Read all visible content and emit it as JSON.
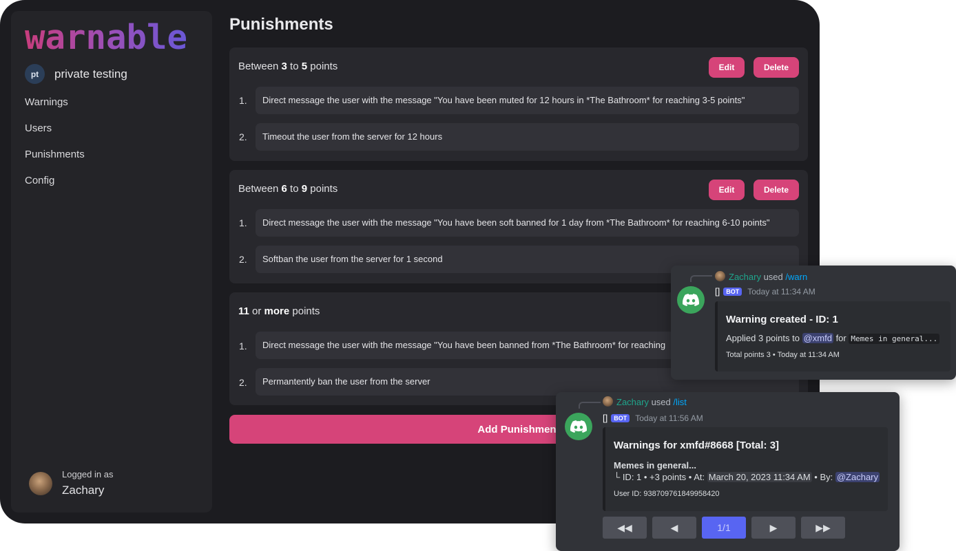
{
  "app": {
    "logo": "warnable",
    "page_title": "Punishments",
    "add_button": "Add Punishment"
  },
  "server": {
    "icon": "pt",
    "name": "private testing"
  },
  "nav": {
    "items": [
      "Warnings",
      "Users",
      "Punishments",
      "Config"
    ]
  },
  "user": {
    "logged_in_label": "Logged in as",
    "name": "Zachary"
  },
  "buttons": {
    "edit": "Edit",
    "delete": "Delete"
  },
  "punishments": [
    {
      "head": {
        "pre": "Between ",
        "a": "3",
        "mid": " to ",
        "b": "5",
        "post": " points"
      },
      "actions": [
        {
          "num": "1.",
          "text": "Direct message the user with the message \"You have been muted for 12 hours in *The Bathroom* for reaching 3-5 points\""
        },
        {
          "num": "2.",
          "text": "Timeout the user from the server for 12 hours"
        }
      ]
    },
    {
      "head": {
        "pre": "Between ",
        "a": "6",
        "mid": " to ",
        "b": "9",
        "post": " points"
      },
      "actions": [
        {
          "num": "1.",
          "text": "Direct message the user with the message \"You have been soft banned for 1 day from *The Bathroom* for reaching 6-10 points\""
        },
        {
          "num": "2.",
          "text": "Softban the user from the server for 1 second"
        }
      ]
    },
    {
      "head": {
        "pre": "",
        "a": "11",
        "mid": " or ",
        "b": "more",
        "post": " points"
      },
      "actions": [
        {
          "num": "1.",
          "text": "Direct message the user with the message \"You have been banned from *The Bathroom* for reaching"
        },
        {
          "num": "2.",
          "text": "Permantently ban the user from the server"
        }
      ]
    }
  ],
  "discord_warn": {
    "user": "Zachary",
    "used": " used ",
    "command": "/warn",
    "bot_name": "[]",
    "bot_tag": "BOT",
    "time": "Today at 11:34 AM",
    "embed": {
      "title": "Warning created - ID: 1",
      "applied_pre": "Applied 3 points to ",
      "mention": "@xmfd",
      "for": " for ",
      "reason": "Memes in general...",
      "footer": "Total points 3 • Today at 11:34 AM"
    }
  },
  "discord_list": {
    "user": "Zachary",
    "used": " used ",
    "command": "/list",
    "bot_name": "[]",
    "bot_tag": "BOT",
    "time": "Today at 11:56 AM",
    "embed": {
      "title": "Warnings for xmfd#8668 [Total: 3]",
      "entry_title": "Memes in general...",
      "entry_pre": "└ ID: 1 • +3 points • At: ",
      "entry_date": "March 20, 2023 11:34 AM",
      "entry_by": " • By: ",
      "entry_mention": "@Zachary",
      "user_id": "User ID: 938709761849958420"
    },
    "pagination": {
      "first": "◀◀",
      "prev": "◀",
      "page": "1/1",
      "next": "▶",
      "last": "▶▶"
    }
  },
  "colors": {
    "accent": "#d64479",
    "page_btn_active": "#5865f2",
    "discord_bg": "#313338"
  }
}
